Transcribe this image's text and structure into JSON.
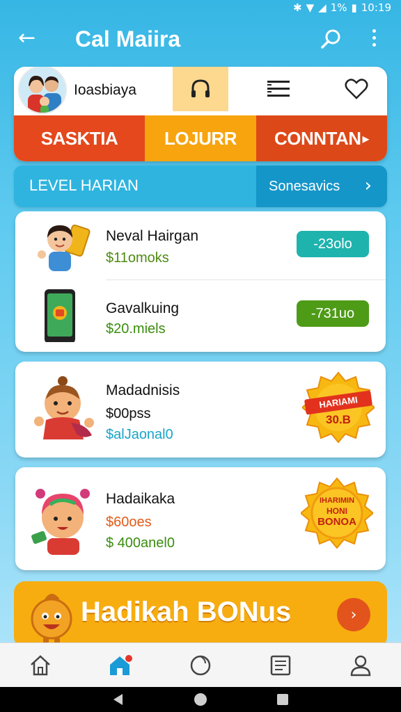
{
  "status_bar": {
    "battery": "1%",
    "time": "10:19"
  },
  "app_bar": {
    "title": "Cal Maiira"
  },
  "profile": {
    "username": "Ioasbiaya"
  },
  "tabs": [
    {
      "label": "SASKTIA"
    },
    {
      "label": "LOJURR"
    },
    {
      "label": "CONNTAN"
    }
  ],
  "level_bar": {
    "label": "LEVEL HARIAN",
    "button": "Sonesavics"
  },
  "offers": [
    {
      "name": "Neval Hairgan",
      "price": "$11omoks",
      "tag": "-23olo",
      "tag_color": "#1fb3ad"
    },
    {
      "name": "Gavalkuing",
      "price": "$20.miels",
      "tag": "-731uo",
      "tag_color": "#4e9b17"
    }
  ],
  "rewards": [
    {
      "name": "Madadnisis",
      "price": "$00pss",
      "sub": "$alJaonal0",
      "badge_line1": "HARIAMI",
      "badge_line2": "30.B"
    },
    {
      "name": "Hadaikaka",
      "price": "$60oes",
      "sub": "$ 400anel0",
      "badge_line1": "IHARIMIN",
      "badge_line2": "HONI",
      "badge_line3": "BONOA"
    }
  ],
  "bonus": {
    "label": "Hadikah BONus"
  },
  "colors": {
    "accent_orange": "#e4481c",
    "accent_yellow": "#f7a40e",
    "teal": "#1fb3ad",
    "green": "#4e9b17",
    "sky": "#36b6e4"
  },
  "bottom_nav": [
    {
      "icon": "home-icon"
    },
    {
      "icon": "store-home-icon"
    },
    {
      "icon": "circle-icon"
    },
    {
      "icon": "document-icon"
    },
    {
      "icon": "profile-icon"
    }
  ]
}
